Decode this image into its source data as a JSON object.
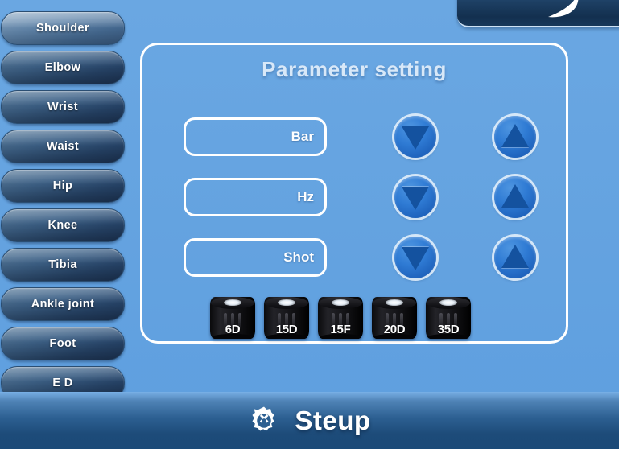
{
  "logo": {
    "icon": "crescent-swoosh-logo"
  },
  "sidebar": {
    "items": [
      {
        "label": "Shoulder",
        "selected": true
      },
      {
        "label": "Elbow",
        "selected": false
      },
      {
        "label": "Wrist",
        "selected": false
      },
      {
        "label": "Waist",
        "selected": false
      },
      {
        "label": "Hip",
        "selected": false
      },
      {
        "label": "Knee",
        "selected": false
      },
      {
        "label": "Tibia",
        "selected": false
      },
      {
        "label": "Ankle joint",
        "selected": false
      },
      {
        "label": "Foot",
        "selected": false
      },
      {
        "label": "E D",
        "selected": false
      }
    ]
  },
  "panel": {
    "title": "Parameter setting",
    "rows": [
      {
        "name": "bar",
        "value": "",
        "unit": "Bar",
        "decrease_icon": "triangle-down-icon",
        "increase_icon": "triangle-up-icon"
      },
      {
        "name": "hz",
        "value": "",
        "unit": "Hz",
        "decrease_icon": "triangle-down-icon",
        "increase_icon": "triangle-up-icon"
      },
      {
        "name": "shot",
        "value": "",
        "unit": "Shot",
        "decrease_icon": "triangle-down-icon",
        "increase_icon": "triangle-up-icon"
      }
    ],
    "transmitters": [
      {
        "label": "6D"
      },
      {
        "label": "15D"
      },
      {
        "label": "15F"
      },
      {
        "label": "20D"
      },
      {
        "label": "35D"
      }
    ]
  },
  "bottom_bar": {
    "icon": "gear-icon",
    "label": "Steup"
  },
  "colors": {
    "background": "#64a3e0",
    "panel_border": "#ffffff",
    "title_text": "#d8e8f8",
    "button_blue": "#2f7bd4",
    "triangle_blue": "#14529f",
    "bottom_bar_dark": "#1b4a78",
    "logo_panel_navy": "#1d3f63"
  }
}
